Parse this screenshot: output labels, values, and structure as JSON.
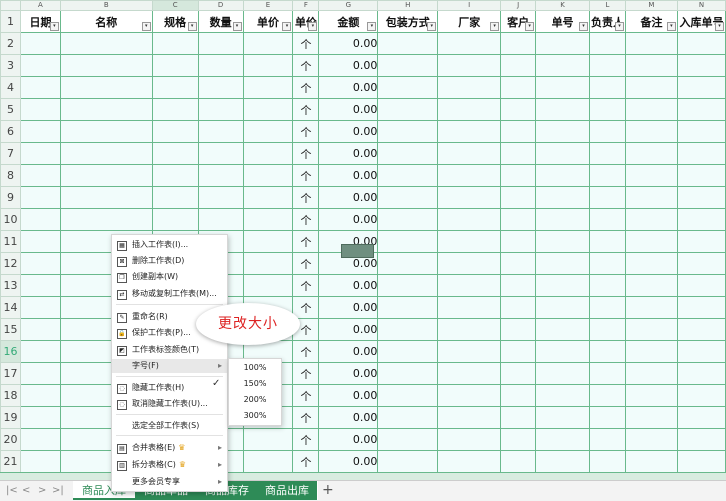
{
  "columns": {
    "letters": [
      "A",
      "B",
      "C",
      "D",
      "E",
      "F",
      "G",
      "H",
      "I",
      "J",
      "K",
      "L",
      "M",
      "N"
    ],
    "headers": [
      "日期",
      "名称",
      "规格",
      "数量",
      "单价",
      "单价",
      "金额",
      "包装方式",
      "厂家",
      "客户",
      "单号",
      "负责人",
      "备注",
      "入库单号"
    ]
  },
  "row_numbers": [
    "1",
    "2",
    "3",
    "4",
    "5",
    "6",
    "7",
    "8",
    "9",
    "10",
    "11",
    "12",
    "13",
    "14",
    "15",
    "16",
    "17",
    "18",
    "19",
    "20",
    "21"
  ],
  "column_f_value": "个",
  "column_g_value": "0.00",
  "context_menu": {
    "items": [
      {
        "label": "插入工作表(I)...",
        "icon": "insert-sheet-icon",
        "symbol": "▦"
      },
      {
        "label": "删除工作表(D)",
        "icon": "delete-sheet-icon",
        "symbol": "⊠"
      },
      {
        "label": "创建副本(W)",
        "icon": "copy-sheet-icon",
        "symbol": "❐"
      },
      {
        "label": "移动或复制工作表(M)...",
        "icon": "move-sheet-icon",
        "symbol": "⇄"
      },
      {
        "label": "重命名(R)",
        "icon": "rename-icon",
        "symbol": "✎"
      },
      {
        "label": "保护工作表(P)...",
        "icon": "protect-sheet-icon",
        "symbol": "🔒"
      },
      {
        "label": "工作表标签颜色(T)",
        "icon": "tab-color-icon",
        "symbol": "◩"
      },
      {
        "label": "字号(F)",
        "icon": "",
        "symbol": ""
      },
      {
        "label": "隐藏工作表(H)",
        "icon": "hide-sheet-icon",
        "symbol": "◌"
      },
      {
        "label": "取消隐藏工作表(U)...",
        "icon": "unhide-sheet-icon",
        "symbol": "◌"
      },
      {
        "label": "选定全部工作表(S)",
        "icon": "",
        "symbol": ""
      },
      {
        "label": "合并表格(E)",
        "icon": "merge-table-icon",
        "symbol": "▤"
      },
      {
        "label": "拆分表格(C)",
        "icon": "split-table-icon",
        "symbol": "▥"
      },
      {
        "label": "更多会员专享",
        "icon": "",
        "symbol": ""
      }
    ]
  },
  "font_size_submenu": {
    "options": [
      "100%",
      "150%",
      "200%",
      "300%"
    ],
    "selected": "150%"
  },
  "annotation_bubble": "更改大小",
  "sheet_tabs": [
    {
      "label": "商品入库",
      "active": true
    },
    {
      "label": "商品单品",
      "active": false
    },
    {
      "label": "商品库存",
      "active": false
    },
    {
      "label": "商品出库",
      "active": false
    }
  ],
  "add_tab_label": "+",
  "colors": {
    "grid": "#69b98c",
    "cell_bg": "#f1fcfb",
    "tab": "#2e8b57",
    "annotation": "#dd2222"
  }
}
